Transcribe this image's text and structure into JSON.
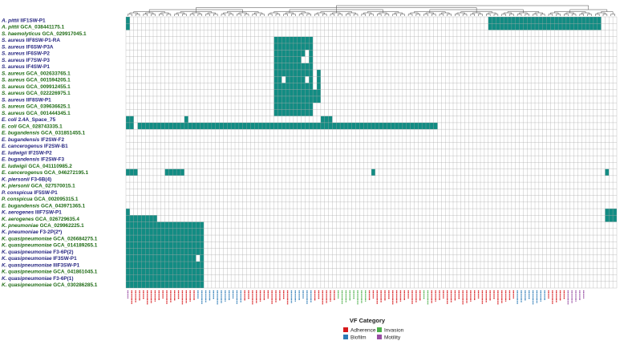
{
  "colors": {
    "present": "#128c83",
    "absent": "#ffffff",
    "grid": "#a8a8a8",
    "label_green": "#1e6b14",
    "label_blue": "#262681",
    "Adherence": "#d7191c",
    "Biofilm": "#2c7bb6",
    "Invasion": "#4daf4a",
    "Motility": "#984ea3"
  },
  "chart_data": {
    "type": "heatmap",
    "legend": {
      "title": "VF Category",
      "position": "bottom-center",
      "entries": [
        {
          "name": "Adherence",
          "color": "#d7191c"
        },
        {
          "name": "Invasion",
          "color": "#4daf4a"
        },
        {
          "name": "Biofilm",
          "color": "#2c7bb6"
        },
        {
          "name": "Motility",
          "color": "#984ea3"
        }
      ]
    },
    "rows": [
      {
        "genus": "A. pittii",
        "strain": "IIF1SW-P1",
        "color": "blue"
      },
      {
        "genus": "A. pittii",
        "strain": "GCA_038441175.1",
        "color": "green"
      },
      {
        "genus": "S. haemolyticus",
        "strain": "GCA_029917045.1",
        "color": "green"
      },
      {
        "genus": "S. aureus",
        "strain": "IIF8SW-P1-RA",
        "color": "blue"
      },
      {
        "genus": "S. aureus",
        "strain": "IF6SW-P3A",
        "color": "blue"
      },
      {
        "genus": "S. aureus",
        "strain": "IF6SW-P2",
        "color": "blue"
      },
      {
        "genus": "S. aureus",
        "strain": "IF7SW-P3",
        "color": "blue"
      },
      {
        "genus": "S. aureus",
        "strain": "IF4SW-P1",
        "color": "blue"
      },
      {
        "genus": "S. aureus",
        "strain": "GCA_002633765.1",
        "color": "green"
      },
      {
        "genus": "S. aureus",
        "strain": "GCA_001594205.1",
        "color": "green"
      },
      {
        "genus": "S. aureus",
        "strain": "GCA_009912455.1",
        "color": "green"
      },
      {
        "genus": "S. aureus",
        "strain": "GCA_022226975.1",
        "color": "green"
      },
      {
        "genus": "S. aureus",
        "strain": "IIF8SW-P1",
        "color": "blue"
      },
      {
        "genus": "S. aureus",
        "strain": "GCA_039636625.1",
        "color": "green"
      },
      {
        "genus": "S. aureus",
        "strain": "GCA_001444345.1",
        "color": "green"
      },
      {
        "genus": "E. coli",
        "strain": "2.4A_Space_75",
        "color": "blue"
      },
      {
        "genus": "E. coli",
        "strain": "GCA_028743335.1",
        "color": "green"
      },
      {
        "genus": "E. bugandensis",
        "strain": "GCA_031851455.1",
        "color": "green"
      },
      {
        "genus": "E. bugandensis",
        "strain": "IF2SW-F2",
        "color": "blue"
      },
      {
        "genus": "E. cancerogenus",
        "strain": "IF2SW-B1",
        "color": "blue"
      },
      {
        "genus": "E. ludwigii",
        "strain": "IF2SW-P2",
        "color": "blue"
      },
      {
        "genus": "E. bugandensis",
        "strain": "IF2SW-F3",
        "color": "blue"
      },
      {
        "genus": "E. ludwigii",
        "strain": "GCA_041110985.2",
        "color": "green"
      },
      {
        "genus": "E. cancerogenus",
        "strain": "GCA_046272195.1",
        "color": "green"
      },
      {
        "genus": "K. piersonii",
        "strain": "F3-6B(4)",
        "color": "blue"
      },
      {
        "genus": "K. piersonii",
        "strain": "GCA_027570015.1",
        "color": "green"
      },
      {
        "genus": "P. conspicua",
        "strain": "IF5SW-P1",
        "color": "blue"
      },
      {
        "genus": "P. conspicua",
        "strain": "GCA_002095315.1",
        "color": "green"
      },
      {
        "genus": "E. bugandensis",
        "strain": "GCA_043971365.1",
        "color": "green"
      },
      {
        "genus": "K. aerogenes",
        "strain": "IIIF7SW-P1",
        "color": "blue"
      },
      {
        "genus": "K. aerogenes",
        "strain": "GCA_026729635.4",
        "color": "green"
      },
      {
        "genus": "K. pneumoniae",
        "strain": "GCA_029962225.1",
        "color": "green"
      },
      {
        "genus": "K. pneumoniae",
        "strain": "F3-2P(2*)",
        "color": "blue"
      },
      {
        "genus": "K. quasipneumoniae",
        "strain": "GCA_026684275.1",
        "color": "green"
      },
      {
        "genus": "K. quasipneumoniae",
        "strain": "GCA_014189265.1",
        "color": "green"
      },
      {
        "genus": "K. quasipneumoniae",
        "strain": "F3-6P(2)",
        "color": "blue"
      },
      {
        "genus": "K. quasipneumoniae",
        "strain": "IF3SW-P1",
        "color": "blue"
      },
      {
        "genus": "K. quasipneumoniae",
        "strain": "IIIF3SW-P1",
        "color": "blue"
      },
      {
        "genus": "K. quasipneumoniae",
        "strain": "GCA_041861045.1",
        "color": "green"
      },
      {
        "genus": "K. quasipneumoniae",
        "strain": "F3-6P(1)",
        "color": "blue"
      },
      {
        "genus": "K. quasipneumoniae",
        "strain": "GCA_030286285.1",
        "color": "green"
      }
    ],
    "column_categories": [
      "Motility",
      "Adherence",
      "Adherence",
      "Adherence",
      "Adherence",
      "Adherence",
      "Adherence",
      "Adherence",
      "Adherence",
      "Adherence",
      "Adherence",
      "Adherence",
      "Adherence",
      "Adherence",
      "Adherence",
      "Adherence",
      "Adherence",
      "Adherence",
      "Biofilm",
      "Biofilm",
      "Biofilm",
      "Biofilm",
      "Biofilm",
      "Biofilm",
      "Biofilm",
      "Biofilm",
      "Biofilm",
      "Biofilm",
      "Biofilm",
      "Biofilm",
      "Adherence",
      "Adherence",
      "Adherence",
      "Adherence",
      "Adherence",
      "Adherence",
      "Adherence",
      "Adherence",
      "Adherence",
      "Adherence",
      "Adherence",
      "Adherence",
      "Biofilm",
      "Biofilm",
      "Biofilm",
      "Biofilm",
      "Biofilm",
      "Biofilm",
      "Adherence",
      "Adherence",
      "Adherence",
      "Adherence",
      "Adherence",
      "Adherence",
      "Invasion",
      "Invasion",
      "Invasion",
      "Invasion",
      "Invasion",
      "Invasion",
      "Invasion",
      "Invasion",
      "Adherence",
      "Adherence",
      "Adherence",
      "Adherence",
      "Adherence",
      "Adherence",
      "Adherence",
      "Adherence",
      "Adherence",
      "Adherence",
      "Adherence",
      "Adherence",
      "Adherence",
      "Adherence",
      "Invasion",
      "Invasion",
      "Adherence",
      "Adherence",
      "Adherence",
      "Adherence",
      "Adherence",
      "Adherence",
      "Adherence",
      "Adherence",
      "Adherence",
      "Adherence",
      "Adherence",
      "Adherence",
      "Adherence",
      "Adherence",
      "Adherence",
      "Adherence",
      "Adherence",
      "Adherence",
      "Adherence",
      "Adherence",
      "Adherence",
      "Adherence",
      "Biofilm",
      "Biofilm",
      "Biofilm",
      "Biofilm",
      "Biofilm",
      "Biofilm",
      "Biofilm",
      "Biofilm",
      "Adherence",
      "Adherence",
      "Adherence",
      "Adherence",
      "Adherence",
      "Motility",
      "Motility",
      "Motility",
      "Motility",
      "Motility"
    ],
    "presence_runs": [
      [
        [
          0,
          1
        ],
        [
          93,
          122
        ]
      ],
      [
        [
          0,
          1
        ],
        [
          93,
          122
        ]
      ],
      [],
      [
        [
          38,
          48
        ]
      ],
      [
        [
          38,
          48
        ]
      ],
      [
        [
          38,
          46
        ],
        [
          47,
          48
        ]
      ],
      [
        [
          38,
          45
        ],
        [
          47,
          48
        ]
      ],
      [
        [
          38,
          48
        ]
      ],
      [
        [
          38,
          48
        ],
        [
          49,
          50
        ]
      ],
      [
        [
          38,
          40
        ],
        [
          41,
          46
        ],
        [
          47,
          48
        ],
        [
          49,
          50
        ]
      ],
      [
        [
          38,
          48
        ],
        [
          49,
          50
        ]
      ],
      [
        [
          38,
          50
        ]
      ],
      [
        [
          38,
          50
        ]
      ],
      [
        [
          38,
          48
        ]
      ],
      [
        [
          38,
          48
        ]
      ],
      [
        [
          0,
          2
        ],
        [
          15,
          16
        ],
        [
          50,
          53
        ]
      ],
      [
        [
          0,
          2
        ],
        [
          3,
          80
        ]
      ],
      [],
      [],
      [],
      [],
      [],
      [],
      [
        [
          0,
          3
        ],
        [
          10,
          15
        ],
        [
          63,
          64
        ],
        [
          123,
          124
        ]
      ],
      [],
      [],
      [],
      [],
      [],
      [
        [
          0,
          1
        ],
        [
          123,
          126
        ]
      ],
      [
        [
          0,
          8
        ],
        [
          123,
          126
        ]
      ],
      [
        [
          0,
          20
        ]
      ],
      [
        [
          0,
          20
        ]
      ],
      [
        [
          0,
          20
        ]
      ],
      [
        [
          0,
          20
        ]
      ],
      [
        [
          0,
          20
        ]
      ],
      [
        [
          0,
          18
        ],
        [
          19,
          20
        ]
      ],
      [
        [
          0,
          20
        ]
      ],
      [
        [
          0,
          20
        ]
      ],
      [
        [
          0,
          20
        ]
      ],
      [
        [
          0,
          20
        ]
      ]
    ],
    "n_columns": 126
  }
}
